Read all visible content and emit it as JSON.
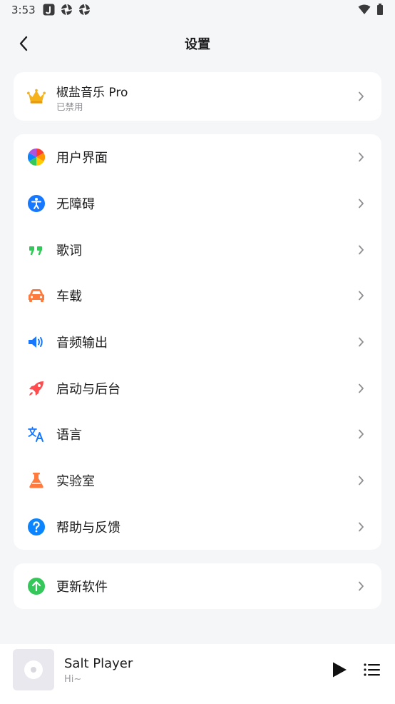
{
  "status_bar": {
    "time": "3:53",
    "icons": [
      "notification-app-icon",
      "aperture-icon",
      "aperture-icon",
      "wifi-icon",
      "battery-icon"
    ]
  },
  "header": {
    "title": "设置",
    "back_icon": "back-arrow-icon"
  },
  "pro": {
    "title": "椒盐音乐 Pro",
    "subtitle": "已禁用",
    "icon": "crown-icon"
  },
  "settings": [
    {
      "label": "用户界面",
      "icon": "color-wheel-icon"
    },
    {
      "label": "无障碍",
      "icon": "accessibility-icon"
    },
    {
      "label": "歌词",
      "icon": "quote-icon"
    },
    {
      "label": "车载",
      "icon": "car-icon"
    },
    {
      "label": "音频输出",
      "icon": "speaker-icon"
    },
    {
      "label": "启动与后台",
      "icon": "rocket-icon"
    },
    {
      "label": "语言",
      "icon": "translate-icon"
    },
    {
      "label": "实验室",
      "icon": "flask-icon"
    },
    {
      "label": "帮助与反馈",
      "icon": "help-icon"
    }
  ],
  "update": {
    "label": "更新软件",
    "icon": "update-arrow-icon"
  },
  "player": {
    "title": "Salt Player",
    "subtitle": "Hi~"
  },
  "colors": {
    "background": "#f5f6f8",
    "card": "#ffffff",
    "accessibility_blue": "#1677ff",
    "lyrics_green": "#34c759",
    "car_orange": "#ff7a3d",
    "rocket_red": "#ff4d4f",
    "help_blue": "#0a84ff",
    "update_green": "#34c759"
  }
}
